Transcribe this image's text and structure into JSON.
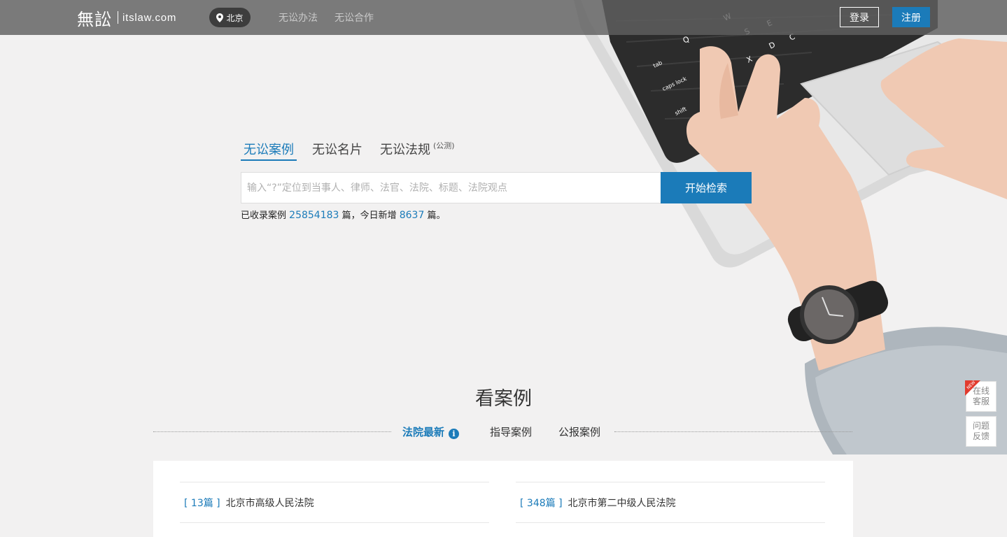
{
  "header": {
    "logo_cn": "無訟",
    "logo_en": "itslaw.com",
    "city": "北京",
    "nav": [
      "无讼办法",
      "无讼合作"
    ],
    "login_label": "登录",
    "register_label": "注册"
  },
  "search": {
    "tabs": [
      {
        "label": "无讼案例",
        "active": true
      },
      {
        "label": "无讼名片",
        "active": false
      },
      {
        "label": "无讼法规",
        "active": false,
        "badge": "(公测)"
      }
    ],
    "placeholder": "输入“?”定位到当事人、律师、法官、法院、标题、法院观点",
    "value": "",
    "button_label": "开始检索",
    "stats": {
      "prefix": "已收录案例",
      "total": "25854183",
      "mid": "篇，今日新增",
      "today": "8637",
      "suffix": "篇。"
    }
  },
  "cases": {
    "title": "看案例",
    "tabs": [
      {
        "label": "法院最新",
        "active": true,
        "info_icon": "i"
      },
      {
        "label": "指导案例",
        "active": false
      },
      {
        "label": "公报案例",
        "active": false
      }
    ],
    "courts": [
      {
        "count": "[ 13篇 ]",
        "name": "北京市高级人民法院"
      },
      {
        "count": "[ 348篇 ]",
        "name": "北京市第二中级人民法院"
      }
    ]
  },
  "side_widgets": [
    {
      "line1": "在线",
      "line2": "客服",
      "badge": "NEW"
    },
    {
      "line1": "问题",
      "line2": "反馈"
    }
  ],
  "colors": {
    "accent": "#1b7bb9",
    "topbar": "#5f5f5f",
    "background": "#f2f1f1"
  },
  "icons": {
    "city": "location-pin-icon",
    "info": "info-circle-icon",
    "badge": "new-badge-icon"
  }
}
